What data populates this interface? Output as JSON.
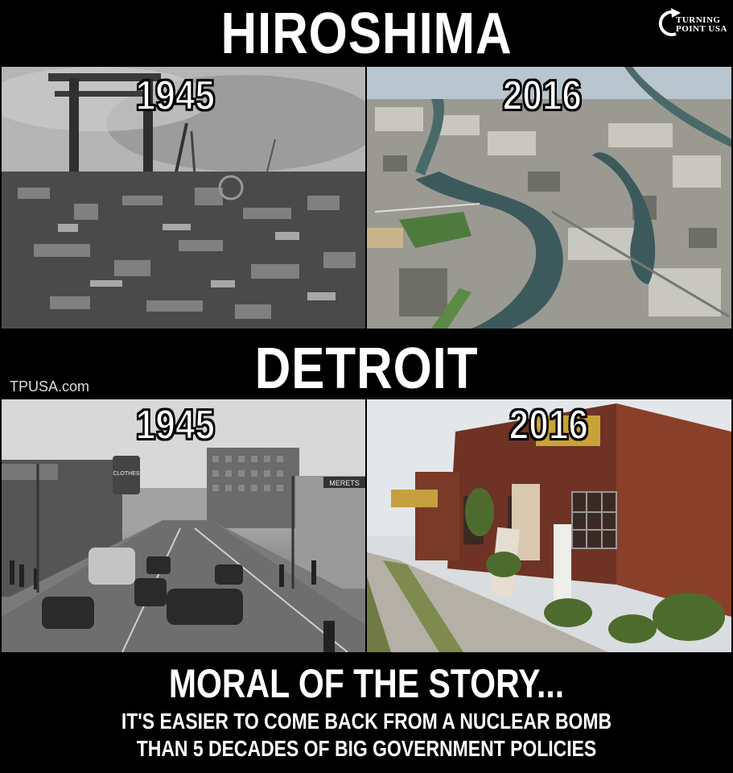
{
  "header": {
    "title": "HIROSHIMA"
  },
  "logo": {
    "line1": "TURNING",
    "line2": "POINT USA"
  },
  "hiroshima": {
    "then": {
      "year": "1945"
    },
    "now": {
      "year": "2016"
    }
  },
  "middle": {
    "title": "DETROIT",
    "site": "TPUSA.com"
  },
  "detroit": {
    "then": {
      "year": "1945",
      "signs": [
        "MERETS",
        "CLOTHES"
      ]
    },
    "now": {
      "year": "2016"
    }
  },
  "footer": {
    "headline": "MORAL OF THE STORY...",
    "line1": "IT'S EASIER TO COME BACK FROM A NUCLEAR BOMB",
    "line2": "THAN 5 DECADES OF BIG GOVERNMENT POLICIES"
  }
}
